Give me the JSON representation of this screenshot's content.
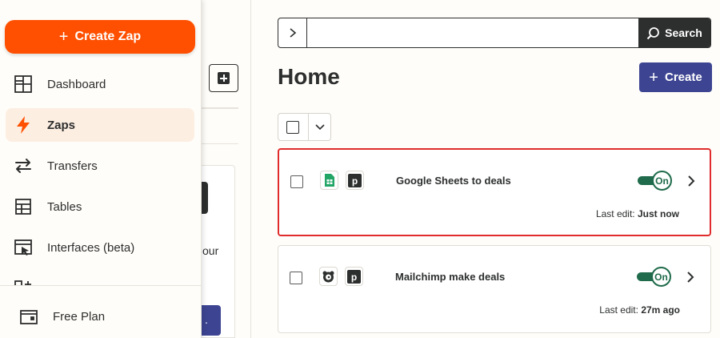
{
  "sidebar": {
    "create_label": "Create Zap",
    "items": [
      {
        "label": "Dashboard",
        "icon": "dashboard-icon"
      },
      {
        "label": "Zaps",
        "icon": "zap-icon"
      },
      {
        "label": "Transfers",
        "icon": "transfers-icon"
      },
      {
        "label": "Tables",
        "icon": "tables-icon"
      },
      {
        "label": "Interfaces (beta)",
        "icon": "interfaces-icon"
      }
    ],
    "footer_label": "Free Plan"
  },
  "background": {
    "partial_text": "our"
  },
  "search": {
    "value": "",
    "button_label": "Search"
  },
  "main": {
    "title": "Home",
    "create_label": "Create"
  },
  "zaps": [
    {
      "name": "Google Sheets to deals",
      "status": "On",
      "last_edit_label": "Last edit:",
      "last_edit_value": "Just now",
      "apps": [
        "google-sheets-icon",
        "pipedrive-icon"
      ]
    },
    {
      "name": "Mailchimp make deals",
      "status": "On",
      "last_edit_label": "Last edit:",
      "last_edit_value": "27m ago",
      "apps": [
        "mailchimp-icon",
        "pipedrive-icon"
      ]
    }
  ],
  "colors": {
    "brand_orange": "#ff4f00",
    "primary_button": "#3d4592",
    "toggle_on": "#1f6b4b",
    "selection_highlight": "#e02c2c"
  }
}
